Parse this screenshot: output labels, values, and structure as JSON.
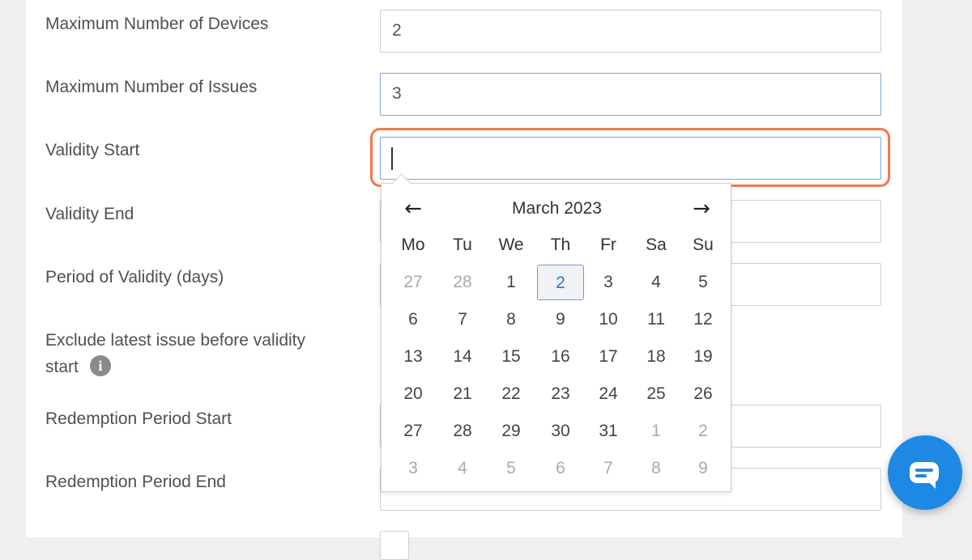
{
  "form": {
    "max_devices_label": "Maximum Number of Devices",
    "max_devices_value": "2",
    "max_issues_label": "Maximum Number of Issues",
    "max_issues_value": "3",
    "validity_start_label": "Validity Start",
    "validity_start_value": "",
    "validity_end_label": "Validity End",
    "period_label": "Period of Validity (days)",
    "exclude_label": "Exclude latest issue before validity start",
    "exclude_info_icon": "i",
    "redemption_start_label": "Redemption Period Start",
    "redemption_end_label": "Redemption Period End"
  },
  "datepicker": {
    "title": "March 2023",
    "prev_icon": "←",
    "next_icon": "→",
    "weekdays": [
      "Mo",
      "Tu",
      "We",
      "Th",
      "Fr",
      "Sa",
      "Su"
    ],
    "weeks": [
      [
        {
          "d": "27",
          "m": true
        },
        {
          "d": "28",
          "m": true
        },
        {
          "d": "1"
        },
        {
          "d": "2",
          "sel": true
        },
        {
          "d": "3"
        },
        {
          "d": "4"
        },
        {
          "d": "5"
        }
      ],
      [
        {
          "d": "6"
        },
        {
          "d": "7"
        },
        {
          "d": "8"
        },
        {
          "d": "9"
        },
        {
          "d": "10"
        },
        {
          "d": "11"
        },
        {
          "d": "12"
        }
      ],
      [
        {
          "d": "13"
        },
        {
          "d": "14"
        },
        {
          "d": "15"
        },
        {
          "d": "16"
        },
        {
          "d": "17"
        },
        {
          "d": "18"
        },
        {
          "d": "19"
        }
      ],
      [
        {
          "d": "20"
        },
        {
          "d": "21"
        },
        {
          "d": "22"
        },
        {
          "d": "23"
        },
        {
          "d": "24"
        },
        {
          "d": "25"
        },
        {
          "d": "26"
        }
      ],
      [
        {
          "d": "27"
        },
        {
          "d": "28"
        },
        {
          "d": "29"
        },
        {
          "d": "30"
        },
        {
          "d": "31"
        },
        {
          "d": "1",
          "m": true
        },
        {
          "d": "2",
          "m": true
        }
      ],
      [
        {
          "d": "3",
          "m": true
        },
        {
          "d": "4",
          "m": true
        },
        {
          "d": "5",
          "m": true
        },
        {
          "d": "6",
          "m": true
        },
        {
          "d": "7",
          "m": true
        },
        {
          "d": "8",
          "m": true
        },
        {
          "d": "9",
          "m": true
        }
      ]
    ]
  },
  "colors": {
    "highlight": "#f07a4a",
    "selected_text": "#2b73c4",
    "chat_button": "#1e88e5"
  },
  "icons": {
    "chat": "chat-bubble-icon",
    "info": "info-icon",
    "prev": "arrow-left-icon",
    "next": "arrow-right-icon"
  }
}
